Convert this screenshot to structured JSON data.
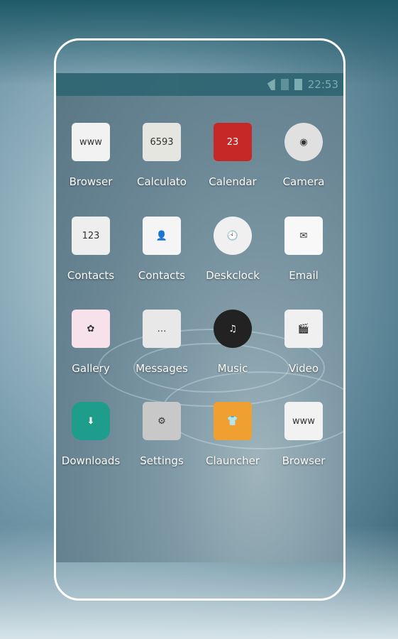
{
  "status_bar": {
    "time": "22:53",
    "icons": [
      "wifi-alert-icon",
      "no-sim-icon",
      "battery-icon"
    ]
  },
  "apps": [
    {
      "label": "Browser",
      "icon": "browser-icon",
      "glyph": "www",
      "bg": "#f2f2f2"
    },
    {
      "label": "Calculato",
      "icon": "calculator-icon",
      "glyph": "6593",
      "bg": "#e6e6e0"
    },
    {
      "label": "Calendar",
      "icon": "calendar-icon",
      "glyph": "23",
      "bg": "#c62828"
    },
    {
      "label": "Camera",
      "icon": "camera-icon",
      "glyph": "◉",
      "bg": "#e0e0e0"
    },
    {
      "label": "Contacts",
      "icon": "dialpad-icon",
      "glyph": "123",
      "bg": "#eeeeee"
    },
    {
      "label": "Contacts",
      "icon": "contacts-card-icon",
      "glyph": "👤",
      "bg": "#f5f5f5"
    },
    {
      "label": "Deskclock",
      "icon": "clock-icon",
      "glyph": "🕙",
      "bg": "#f0f0f0"
    },
    {
      "label": "Email",
      "icon": "envelope-icon",
      "glyph": "✉",
      "bg": "#f8f8f8"
    },
    {
      "label": "Gallery",
      "icon": "gallery-icon",
      "glyph": "✿",
      "bg": "#f7e1ea"
    },
    {
      "label": "Messages",
      "icon": "messages-icon",
      "glyph": "…",
      "bg": "#e8e8e8"
    },
    {
      "label": "Music",
      "icon": "music-icon",
      "glyph": "♫",
      "bg": "#222222"
    },
    {
      "label": "Video",
      "icon": "video-icon",
      "glyph": "🎬",
      "bg": "#f0f0f0"
    },
    {
      "label": "Downloads",
      "icon": "cloud-download-icon",
      "glyph": "⬇",
      "bg": "#1e9c8c"
    },
    {
      "label": "Settings",
      "icon": "settings-gear-icon",
      "glyph": "⚙",
      "bg": "#c8c8c8"
    },
    {
      "label": "Clauncher",
      "icon": "clauncher-shirt-icon",
      "glyph": "👕",
      "bg": "#f0a030"
    },
    {
      "label": "Browser",
      "icon": "browser-icon",
      "glyph": "www",
      "bg": "#f2f2f2"
    }
  ]
}
